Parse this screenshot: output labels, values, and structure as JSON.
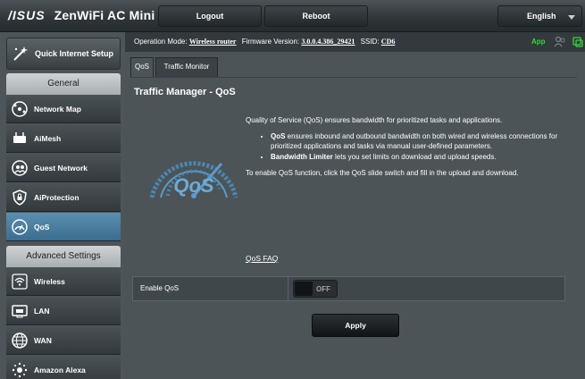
{
  "header": {
    "brand": "/ISUS",
    "product": "ZenWiFi AC Mini",
    "logout_label": "Logout",
    "reboot_label": "Reboot",
    "language": "English"
  },
  "sidebar": {
    "quick_setup": "Quick Internet Setup",
    "general_heading": "General",
    "general_items": [
      {
        "label": "Network Map",
        "icon": "network-map-icon"
      },
      {
        "label": "AiMesh",
        "icon": "aimesh-icon"
      },
      {
        "label": "Guest Network",
        "icon": "guest-network-icon"
      },
      {
        "label": "AiProtection",
        "icon": "shield-icon"
      },
      {
        "label": "QoS",
        "icon": "qos-gauge-icon",
        "active": true
      }
    ],
    "advanced_heading": "Advanced Settings",
    "advanced_items": [
      {
        "label": "Wireless",
        "icon": "wifi-icon"
      },
      {
        "label": "LAN",
        "icon": "lan-icon"
      },
      {
        "label": "WAN",
        "icon": "globe-icon"
      },
      {
        "label": "Amazon Alexa",
        "icon": "alexa-icon"
      }
    ]
  },
  "infobar": {
    "op_mode_label": "Operation Mode:",
    "op_mode_value": "Wireless router",
    "fw_label": "Firmware Version:",
    "fw_value": "3.0.0.4.386_29421",
    "ssid_label": "SSID:",
    "ssid_value": "CD6",
    "app_label": "App"
  },
  "tabs": [
    {
      "label": "QoS",
      "active": true
    },
    {
      "label": "Traffic Monitor",
      "active": false
    }
  ],
  "panel": {
    "title": "Traffic Manager - QoS",
    "intro": "Quality of Service (QoS) ensures bandwidth for prioritized tasks and applications.",
    "bullet1_bold": "QoS",
    "bullet1_text": " ensures inbound and outbound bandwidth on both wired and wireless connections for prioritized applications and tasks via manual user-defined parameters.",
    "bullet2_bold": "Bandwidth Limiter",
    "bullet2_text": " lets you set limits on download and upload speeds.",
    "enable_hint": "To enable QoS function, click the QoS slide switch and fill in the upload and download.",
    "faq_link": "QoS FAQ",
    "gauge_text": "QoS",
    "enable_label": "Enable QoS",
    "toggle_state": "OFF",
    "apply_label": "Apply"
  },
  "colors": {
    "accent_blue": "#4a87b5",
    "app_green": "#34d83a"
  }
}
